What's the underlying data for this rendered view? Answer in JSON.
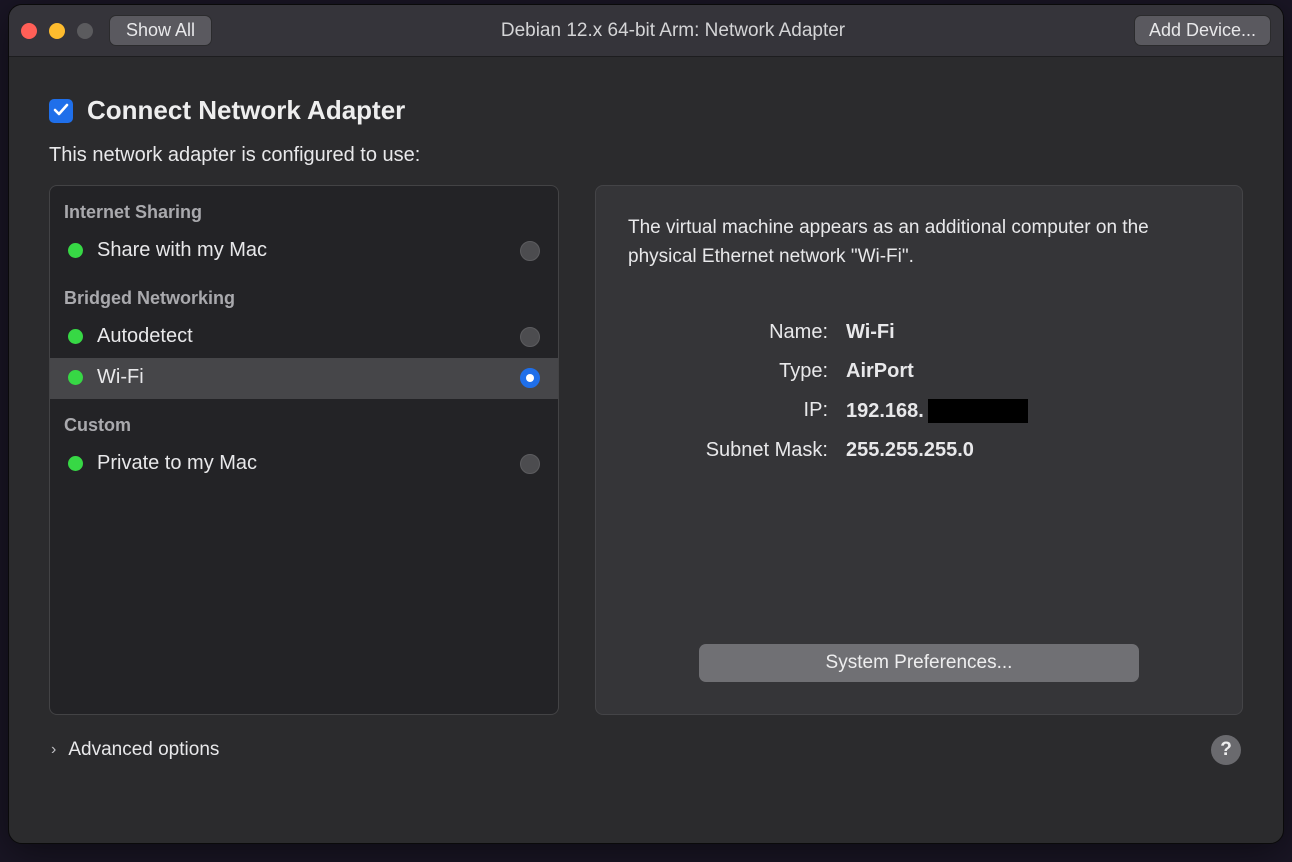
{
  "titlebar": {
    "show_all": "Show All",
    "title": "Debian 12.x 64-bit Arm: Network Adapter",
    "add_device": "Add Device..."
  },
  "connect": {
    "label": "Connect Network Adapter",
    "checked": true
  },
  "subtitle": "This network adapter is configured to use:",
  "left": {
    "sections": [
      {
        "header": "Internet Sharing",
        "items": [
          {
            "label": "Share with my Mac",
            "selected": false
          }
        ]
      },
      {
        "header": "Bridged Networking",
        "items": [
          {
            "label": "Autodetect",
            "selected": false
          },
          {
            "label": "Wi-Fi",
            "selected": true
          }
        ]
      },
      {
        "header": "Custom",
        "items": [
          {
            "label": "Private to my Mac",
            "selected": false
          }
        ]
      }
    ]
  },
  "right": {
    "description": "The virtual machine appears as an additional computer on the physical Ethernet network \"Wi-Fi\".",
    "rows": {
      "name_label": "Name:",
      "name_value": "Wi-Fi",
      "type_label": "Type:",
      "type_value": "AirPort",
      "ip_label": "IP:",
      "ip_value_prefix": "192.168.",
      "subnet_label": "Subnet Mask:",
      "subnet_value": "255.255.255.0"
    },
    "syspref": "System Preferences..."
  },
  "bottom": {
    "advanced": "Advanced options"
  }
}
